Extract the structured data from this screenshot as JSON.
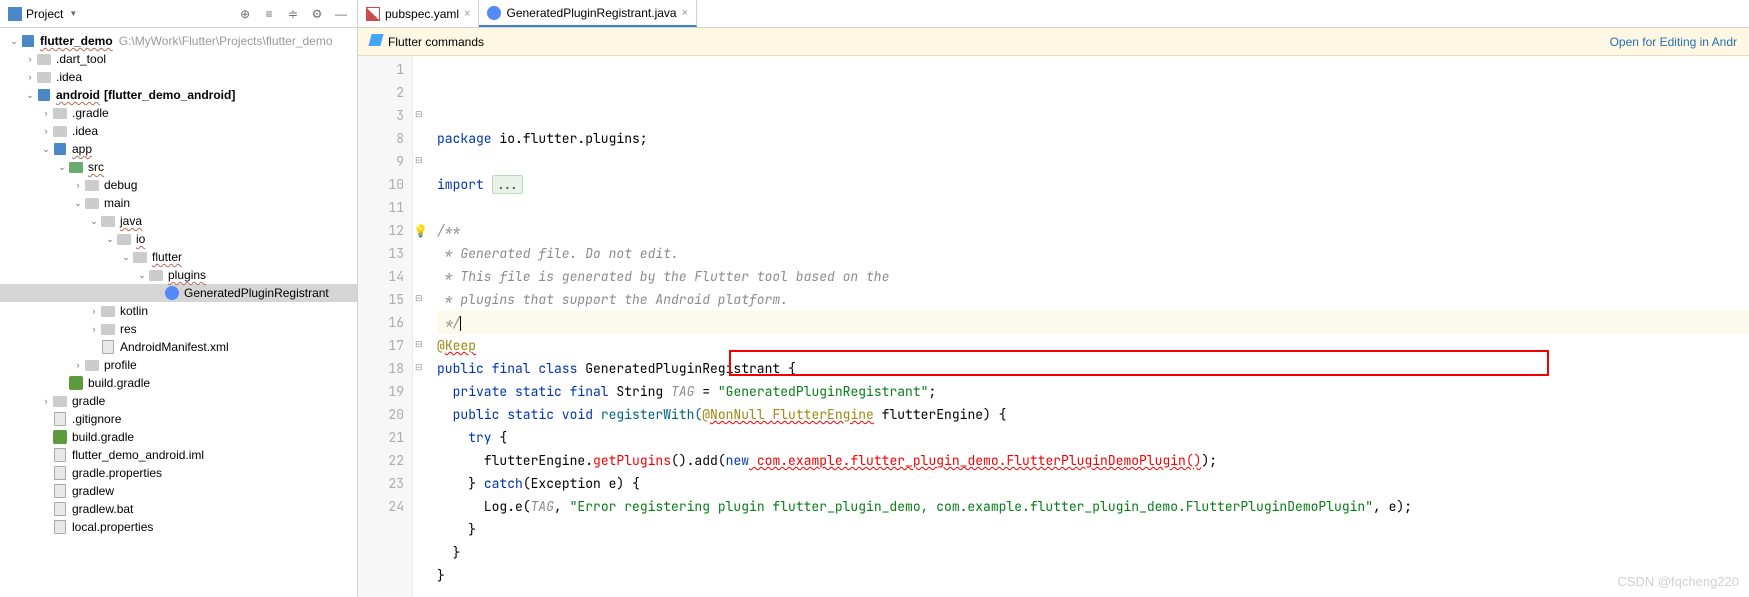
{
  "sidebar": {
    "title": "Project",
    "tools": [
      "locate-icon",
      "collapse-icon",
      "gear-icon",
      "hide-icon"
    ],
    "root_name": "flutter_demo",
    "root_path": "G:\\MyWork\\Flutter\\Projects\\flutter_demo",
    "tree": [
      {
        "depth": 0,
        "arrow": "down",
        "icon": "module",
        "label": "flutter_demo",
        "bold": true,
        "path": "G:\\MyWork\\Flutter\\Projects\\flutter_demo",
        "squiggly": true
      },
      {
        "depth": 1,
        "arrow": "right",
        "icon": "folder",
        "label": ".dart_tool"
      },
      {
        "depth": 1,
        "arrow": "right",
        "icon": "folder",
        "label": ".idea"
      },
      {
        "depth": 1,
        "arrow": "down",
        "icon": "module",
        "label": "android",
        "bold": true,
        "suffix": "[flutter_demo_android]",
        "squiggly": true
      },
      {
        "depth": 2,
        "arrow": "right",
        "icon": "folder",
        "label": ".gradle"
      },
      {
        "depth": 2,
        "arrow": "right",
        "icon": "folder",
        "label": ".idea"
      },
      {
        "depth": 2,
        "arrow": "down",
        "icon": "module",
        "label": "app",
        "squiggly": true
      },
      {
        "depth": 3,
        "arrow": "down",
        "icon": "folder-src",
        "label": "src",
        "squiggly": true
      },
      {
        "depth": 4,
        "arrow": "right",
        "icon": "folder",
        "label": "debug"
      },
      {
        "depth": 4,
        "arrow": "down",
        "icon": "folder",
        "label": "main"
      },
      {
        "depth": 5,
        "arrow": "down",
        "icon": "folder",
        "label": "java",
        "squiggly": true
      },
      {
        "depth": 6,
        "arrow": "down",
        "icon": "folder-pkg",
        "label": "io",
        "squiggly": true
      },
      {
        "depth": 7,
        "arrow": "down",
        "icon": "folder-pkg",
        "label": "flutter",
        "squiggly": true
      },
      {
        "depth": 8,
        "arrow": "down",
        "icon": "folder-pkg",
        "label": "plugins",
        "squiggly": true
      },
      {
        "depth": 9,
        "arrow": "",
        "icon": "class",
        "label": "GeneratedPluginRegistrant",
        "selected": true
      },
      {
        "depth": 5,
        "arrow": "right",
        "icon": "folder",
        "label": "kotlin"
      },
      {
        "depth": 5,
        "arrow": "right",
        "icon": "folder",
        "label": "res"
      },
      {
        "depth": 5,
        "arrow": "",
        "icon": "file",
        "label": "AndroidManifest.xml"
      },
      {
        "depth": 4,
        "arrow": "right",
        "icon": "folder",
        "label": "profile"
      },
      {
        "depth": 3,
        "arrow": "",
        "icon": "gradle",
        "label": "build.gradle"
      },
      {
        "depth": 2,
        "arrow": "right",
        "icon": "folder",
        "label": "gradle"
      },
      {
        "depth": 2,
        "arrow": "",
        "icon": "file",
        "label": ".gitignore"
      },
      {
        "depth": 2,
        "arrow": "",
        "icon": "gradle",
        "label": "build.gradle"
      },
      {
        "depth": 2,
        "arrow": "",
        "icon": "file",
        "label": "flutter_demo_android.iml"
      },
      {
        "depth": 2,
        "arrow": "",
        "icon": "file",
        "label": "gradle.properties"
      },
      {
        "depth": 2,
        "arrow": "",
        "icon": "file",
        "label": "gradlew"
      },
      {
        "depth": 2,
        "arrow": "",
        "icon": "file",
        "label": "gradlew.bat"
      },
      {
        "depth": 2,
        "arrow": "",
        "icon": "file",
        "label": "local.properties"
      }
    ]
  },
  "tabs": [
    {
      "icon": "yml",
      "label": "pubspec.yaml",
      "active": false
    },
    {
      "icon": "class",
      "label": "GeneratedPluginRegistrant.java",
      "active": true
    }
  ],
  "banner": {
    "text": "Flutter commands",
    "link": "Open for Editing in Andr"
  },
  "gutter_lines": [
    "1",
    "2",
    "3",
    "8",
    "9",
    "10",
    "11",
    "12",
    "13",
    "14",
    "15",
    "16",
    "17",
    "18",
    "19",
    "20",
    "21",
    "22",
    "23",
    "24"
  ],
  "gutter_marks": {
    "line3": "fold",
    "line9": "fold",
    "line12": "bulb",
    "line13": "caret",
    "line15": "fold",
    "line17": "fold",
    "line18": "fold"
  },
  "code": {
    "l1_kw": "package",
    "l1_rest": " io.flutter.plugins;",
    "l3_kw": "import",
    "l3_fold": "...",
    "l9": "/**",
    "l10": " * Generated file. Do not edit.",
    "l11": " * This file is generated by the Flutter tool based on the",
    "l12": " * plugins that support the Android platform.",
    "l13": " */",
    "l14_at": "@",
    "l14_ann": "Keep",
    "l15_kw": "public final class",
    "l15_name": " GeneratedPluginRegistrant {",
    "l16_kw": "private static final",
    "l16_type": " String ",
    "l16_var": "TAG",
    "l16_eq": " = ",
    "l16_str": "\"GeneratedPluginRegistrant\"",
    "l16_end": ";",
    "l17_kw": "public static void",
    "l17_m": " registerWith(",
    "l17_at": "@",
    "l17_ann": "NonNull ",
    "l17_ann2": "FlutterEngine",
    "l17_p": " flutterEngine) {",
    "l18_kw": "try",
    "l18_b": " {",
    "l19_a": "      flutterEngine.",
    "l19_g": "getPlugins",
    "l19_b": "().add(",
    "l19_kw": "new",
    "l19_err": " com.example.flutter_plugin_demo.FlutterPluginDemoPlugin()",
    "l19_c": ");",
    "l20_a": "    } ",
    "l20_kw": "catch",
    "l20_b": "(Exception e) {",
    "l21_a": "      Log.e(",
    "l21_tag": "TAG",
    "l21_c": ", ",
    "l21_str": "\"Error registering plugin flutter_plugin_demo, com.example.flutter_plugin_demo.FlutterPluginDemoPlugin\"",
    "l21_e": ", e);",
    "l22": "    }",
    "l23": "  }",
    "l24": "}"
  },
  "watermark": "CSDN @fqcheng220"
}
